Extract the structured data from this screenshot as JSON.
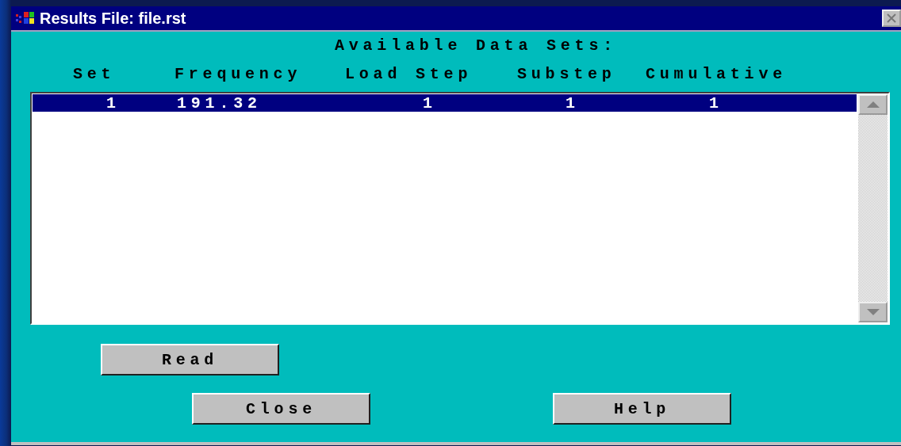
{
  "window": {
    "title": "Results File: file.rst"
  },
  "heading": "Available Data Sets:",
  "table": {
    "columns": [
      "Set",
      "Frequency",
      "Load Step",
      "Substep",
      "Cumulative"
    ],
    "rows": [
      {
        "cells": [
          "1",
          "191.32",
          "1",
          "1",
          "1"
        ],
        "selected": true
      }
    ]
  },
  "buttons": [
    {
      "label": "Read"
    },
    {
      "label": "Close"
    },
    {
      "label": "Help"
    }
  ]
}
